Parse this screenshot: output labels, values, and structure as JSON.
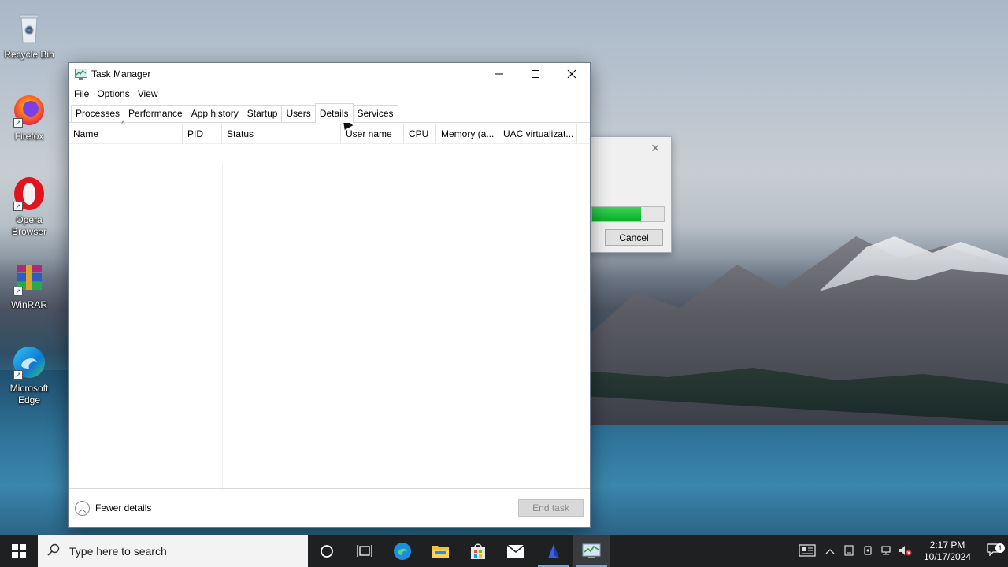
{
  "desktop": {
    "icons": [
      {
        "label": "Recycle Bin"
      },
      {
        "label": "Firefox"
      },
      {
        "label": "Opera Browser"
      },
      {
        "label": "WinRAR"
      },
      {
        "label": "Microsoft Edge"
      }
    ]
  },
  "window": {
    "title": "Task Manager",
    "menu": [
      "File",
      "Options",
      "View"
    ],
    "tabs": [
      "Processes",
      "Performance",
      "App history",
      "Startup",
      "Users",
      "Details",
      "Services"
    ],
    "active_tab": "Details",
    "columns": [
      "Name",
      "PID",
      "Status",
      "User name",
      "CPU",
      "Memory (a...",
      "UAC virtualizat..."
    ],
    "footer": {
      "fewer_details": "Fewer details",
      "end_task": "End task"
    }
  },
  "dialog": {
    "cancel_label": "Cancel",
    "progress": 0.68
  },
  "taskbar": {
    "search_placeholder": "Type here to search",
    "time": "2:17 PM",
    "date": "10/17/2024",
    "notification_count": "1"
  }
}
